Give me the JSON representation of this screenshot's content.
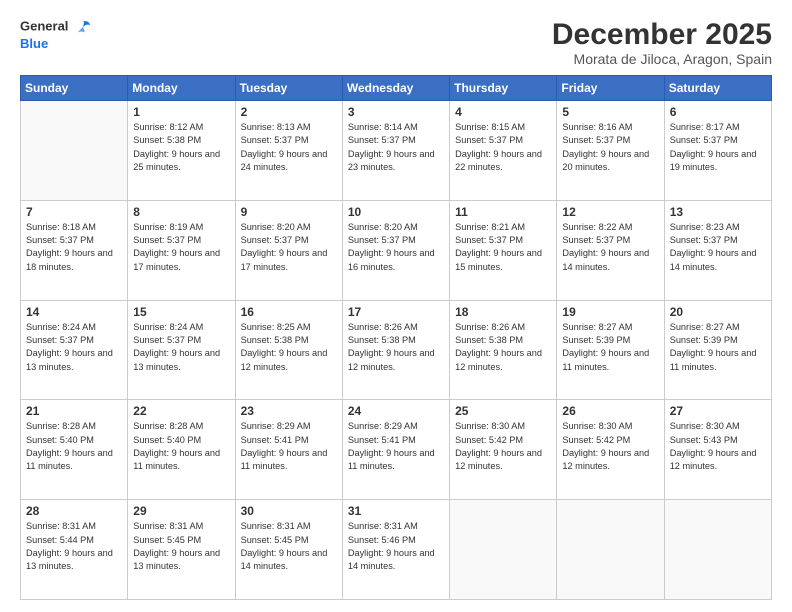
{
  "logo": {
    "line1": "General",
    "line2": "Blue"
  },
  "title": "December 2025",
  "location": "Morata de Jiloca, Aragon, Spain",
  "weekdays": [
    "Sunday",
    "Monday",
    "Tuesday",
    "Wednesday",
    "Thursday",
    "Friday",
    "Saturday"
  ],
  "weeks": [
    [
      {
        "day": "",
        "sunrise": "",
        "sunset": "",
        "daylight": "",
        "empty": true
      },
      {
        "day": "1",
        "sunrise": "Sunrise: 8:12 AM",
        "sunset": "Sunset: 5:38 PM",
        "daylight": "Daylight: 9 hours and 25 minutes."
      },
      {
        "day": "2",
        "sunrise": "Sunrise: 8:13 AM",
        "sunset": "Sunset: 5:37 PM",
        "daylight": "Daylight: 9 hours and 24 minutes."
      },
      {
        "day": "3",
        "sunrise": "Sunrise: 8:14 AM",
        "sunset": "Sunset: 5:37 PM",
        "daylight": "Daylight: 9 hours and 23 minutes."
      },
      {
        "day": "4",
        "sunrise": "Sunrise: 8:15 AM",
        "sunset": "Sunset: 5:37 PM",
        "daylight": "Daylight: 9 hours and 22 minutes."
      },
      {
        "day": "5",
        "sunrise": "Sunrise: 8:16 AM",
        "sunset": "Sunset: 5:37 PM",
        "daylight": "Daylight: 9 hours and 20 minutes."
      },
      {
        "day": "6",
        "sunrise": "Sunrise: 8:17 AM",
        "sunset": "Sunset: 5:37 PM",
        "daylight": "Daylight: 9 hours and 19 minutes."
      }
    ],
    [
      {
        "day": "7",
        "sunrise": "Sunrise: 8:18 AM",
        "sunset": "Sunset: 5:37 PM",
        "daylight": "Daylight: 9 hours and 18 minutes."
      },
      {
        "day": "8",
        "sunrise": "Sunrise: 8:19 AM",
        "sunset": "Sunset: 5:37 PM",
        "daylight": "Daylight: 9 hours and 17 minutes."
      },
      {
        "day": "9",
        "sunrise": "Sunrise: 8:20 AM",
        "sunset": "Sunset: 5:37 PM",
        "daylight": "Daylight: 9 hours and 17 minutes."
      },
      {
        "day": "10",
        "sunrise": "Sunrise: 8:20 AM",
        "sunset": "Sunset: 5:37 PM",
        "daylight": "Daylight: 9 hours and 16 minutes."
      },
      {
        "day": "11",
        "sunrise": "Sunrise: 8:21 AM",
        "sunset": "Sunset: 5:37 PM",
        "daylight": "Daylight: 9 hours and 15 minutes."
      },
      {
        "day": "12",
        "sunrise": "Sunrise: 8:22 AM",
        "sunset": "Sunset: 5:37 PM",
        "daylight": "Daylight: 9 hours and 14 minutes."
      },
      {
        "day": "13",
        "sunrise": "Sunrise: 8:23 AM",
        "sunset": "Sunset: 5:37 PM",
        "daylight": "Daylight: 9 hours and 14 minutes."
      }
    ],
    [
      {
        "day": "14",
        "sunrise": "Sunrise: 8:24 AM",
        "sunset": "Sunset: 5:37 PM",
        "daylight": "Daylight: 9 hours and 13 minutes."
      },
      {
        "day": "15",
        "sunrise": "Sunrise: 8:24 AM",
        "sunset": "Sunset: 5:37 PM",
        "daylight": "Daylight: 9 hours and 13 minutes."
      },
      {
        "day": "16",
        "sunrise": "Sunrise: 8:25 AM",
        "sunset": "Sunset: 5:38 PM",
        "daylight": "Daylight: 9 hours and 12 minutes."
      },
      {
        "day": "17",
        "sunrise": "Sunrise: 8:26 AM",
        "sunset": "Sunset: 5:38 PM",
        "daylight": "Daylight: 9 hours and 12 minutes."
      },
      {
        "day": "18",
        "sunrise": "Sunrise: 8:26 AM",
        "sunset": "Sunset: 5:38 PM",
        "daylight": "Daylight: 9 hours and 12 minutes."
      },
      {
        "day": "19",
        "sunrise": "Sunrise: 8:27 AM",
        "sunset": "Sunset: 5:39 PM",
        "daylight": "Daylight: 9 hours and 11 minutes."
      },
      {
        "day": "20",
        "sunrise": "Sunrise: 8:27 AM",
        "sunset": "Sunset: 5:39 PM",
        "daylight": "Daylight: 9 hours and 11 minutes."
      }
    ],
    [
      {
        "day": "21",
        "sunrise": "Sunrise: 8:28 AM",
        "sunset": "Sunset: 5:40 PM",
        "daylight": "Daylight: 9 hours and 11 minutes."
      },
      {
        "day": "22",
        "sunrise": "Sunrise: 8:28 AM",
        "sunset": "Sunset: 5:40 PM",
        "daylight": "Daylight: 9 hours and 11 minutes."
      },
      {
        "day": "23",
        "sunrise": "Sunrise: 8:29 AM",
        "sunset": "Sunset: 5:41 PM",
        "daylight": "Daylight: 9 hours and 11 minutes."
      },
      {
        "day": "24",
        "sunrise": "Sunrise: 8:29 AM",
        "sunset": "Sunset: 5:41 PM",
        "daylight": "Daylight: 9 hours and 11 minutes."
      },
      {
        "day": "25",
        "sunrise": "Sunrise: 8:30 AM",
        "sunset": "Sunset: 5:42 PM",
        "daylight": "Daylight: 9 hours and 12 minutes."
      },
      {
        "day": "26",
        "sunrise": "Sunrise: 8:30 AM",
        "sunset": "Sunset: 5:42 PM",
        "daylight": "Daylight: 9 hours and 12 minutes."
      },
      {
        "day": "27",
        "sunrise": "Sunrise: 8:30 AM",
        "sunset": "Sunset: 5:43 PM",
        "daylight": "Daylight: 9 hours and 12 minutes."
      }
    ],
    [
      {
        "day": "28",
        "sunrise": "Sunrise: 8:31 AM",
        "sunset": "Sunset: 5:44 PM",
        "daylight": "Daylight: 9 hours and 13 minutes."
      },
      {
        "day": "29",
        "sunrise": "Sunrise: 8:31 AM",
        "sunset": "Sunset: 5:45 PM",
        "daylight": "Daylight: 9 hours and 13 minutes."
      },
      {
        "day": "30",
        "sunrise": "Sunrise: 8:31 AM",
        "sunset": "Sunset: 5:45 PM",
        "daylight": "Daylight: 9 hours and 14 minutes."
      },
      {
        "day": "31",
        "sunrise": "Sunrise: 8:31 AM",
        "sunset": "Sunset: 5:46 PM",
        "daylight": "Daylight: 9 hours and 14 minutes."
      },
      {
        "day": "",
        "sunrise": "",
        "sunset": "",
        "daylight": "",
        "empty": true
      },
      {
        "day": "",
        "sunrise": "",
        "sunset": "",
        "daylight": "",
        "empty": true
      },
      {
        "day": "",
        "sunrise": "",
        "sunset": "",
        "daylight": "",
        "empty": true
      }
    ]
  ]
}
